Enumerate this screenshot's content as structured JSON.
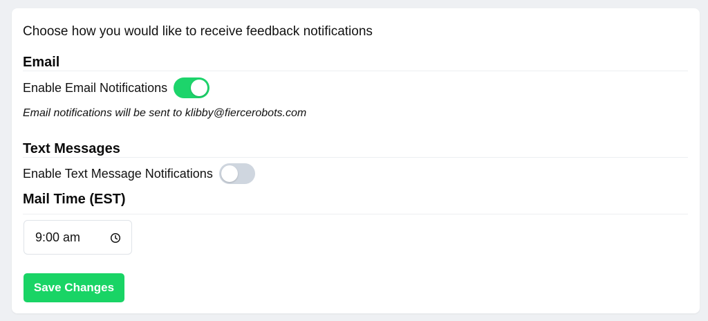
{
  "intro": "Choose how you would like to receive feedback notifications",
  "email": {
    "title": "Email",
    "toggle_label": "Enable Email Notifications",
    "enabled": true,
    "note": "Email notifications will be sent to klibby@fiercerobots.com"
  },
  "text_messages": {
    "title": "Text Messages",
    "toggle_label": "Enable Text Message Notifications",
    "enabled": false
  },
  "mail_time": {
    "title": "Mail Time (EST)",
    "value": "9:00 am",
    "icon": "clock-icon"
  },
  "actions": {
    "save_label": "Save Changes"
  },
  "colors": {
    "accent": "#19d465",
    "toggle_off": "#cfd6df",
    "background": "#eef0f3",
    "card": "#ffffff"
  }
}
